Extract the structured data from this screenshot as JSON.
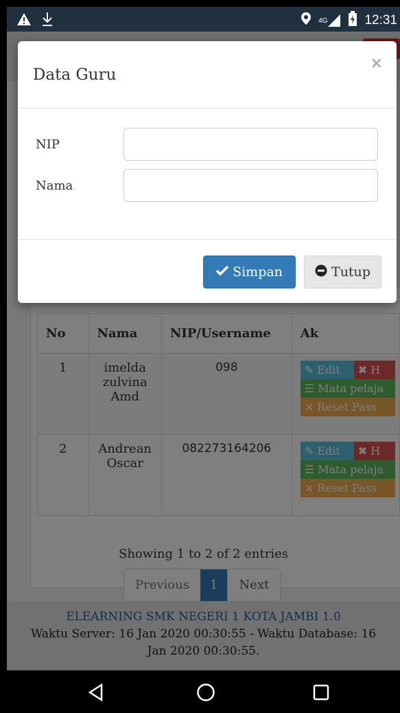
{
  "status_bar": {
    "icons": [
      "warning-icon",
      "download-icon",
      "location-icon",
      "signal-icon",
      "battery-icon"
    ],
    "network": "4G",
    "time": "12:31"
  },
  "modal": {
    "title": "Data Guru",
    "close": "×",
    "fields": [
      {
        "label": "NIP",
        "value": ""
      },
      {
        "label": "Nama",
        "value": ""
      }
    ],
    "save_label": "Simpan",
    "close_label": "Tutup"
  },
  "table": {
    "headers": [
      "No",
      "Nama",
      "NIP/Username",
      "Ak"
    ],
    "rows": [
      {
        "no": "1",
        "nama_lines": [
          "imelda",
          "zulvina",
          "Amd"
        ],
        "nip": "098"
      },
      {
        "no": "2",
        "nama_lines": [
          "Andrean",
          "Oscar"
        ],
        "nip": "082273164206"
      }
    ],
    "actions": {
      "edit": "Edit",
      "hapus": "H",
      "mapel": "Mata pelaja",
      "reset": "Reset Pass"
    }
  },
  "pagination": {
    "info": "Showing 1 to 2 of 2 entries",
    "previous": "Previous",
    "current": "1",
    "next": "Next"
  },
  "footer": {
    "brand": "ELEARNING SMK NEGERI 1 KOTA JAMBI 1.0",
    "line1": "Waktu Server: 16 Jan 2020 00:30:55 - Waktu Database: 16",
    "line2": "Jan 2020 00:30:55."
  },
  "colors": {
    "primary": "#337ab7",
    "info": "#5bc0de",
    "danger": "#d9534f",
    "success": "#5cb85c",
    "warning": "#f0ad4e",
    "status_bar": "#20303f"
  }
}
